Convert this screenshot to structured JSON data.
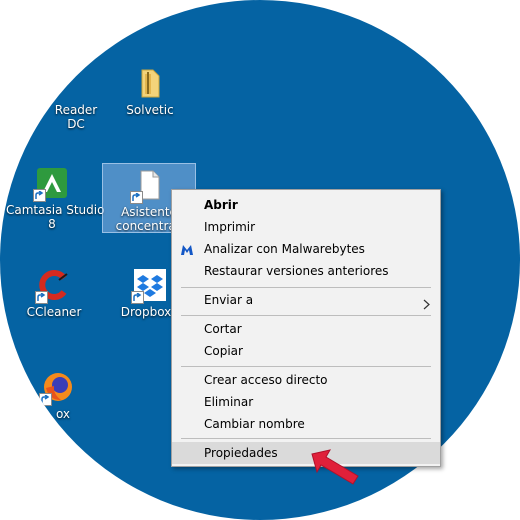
{
  "desktop": {
    "background_color": "#0563a3",
    "icons": [
      {
        "label": "Reader\nDC",
        "icon": "adobe-reader-icon"
      },
      {
        "label": "Solvetic",
        "icon": "folder-icon"
      },
      {
        "label": "Camtasia Studio\n8",
        "icon": "camtasia-icon"
      },
      {
        "label": "Asistente\nconcentrac",
        "icon": "document-icon"
      },
      {
        "label": "CCleaner",
        "icon": "ccleaner-icon"
      },
      {
        "label": "Dropbox",
        "icon": "dropbox-icon"
      },
      {
        "label": "ox",
        "icon": "firefox-icon"
      }
    ]
  },
  "context_menu": {
    "items": [
      {
        "label": "Abrir",
        "bold": true
      },
      {
        "label": "Imprimir"
      },
      {
        "label": "Analizar con Malwarebytes",
        "icon": "malwarebytes-icon"
      },
      {
        "label": "Restaurar versiones anteriores"
      },
      {
        "label": "Enviar a",
        "submenu": true
      },
      {
        "label": "Cortar"
      },
      {
        "label": "Copiar"
      },
      {
        "label": "Crear acceso directo"
      },
      {
        "label": "Eliminar"
      },
      {
        "label": "Cambiar nombre"
      },
      {
        "label": "Propiedades",
        "highlighted": true
      }
    ]
  },
  "accent_colors": {
    "menu_background": "#f2f2f2",
    "menu_highlight": "#dadada",
    "pointer_arrow": "#e0203a"
  }
}
